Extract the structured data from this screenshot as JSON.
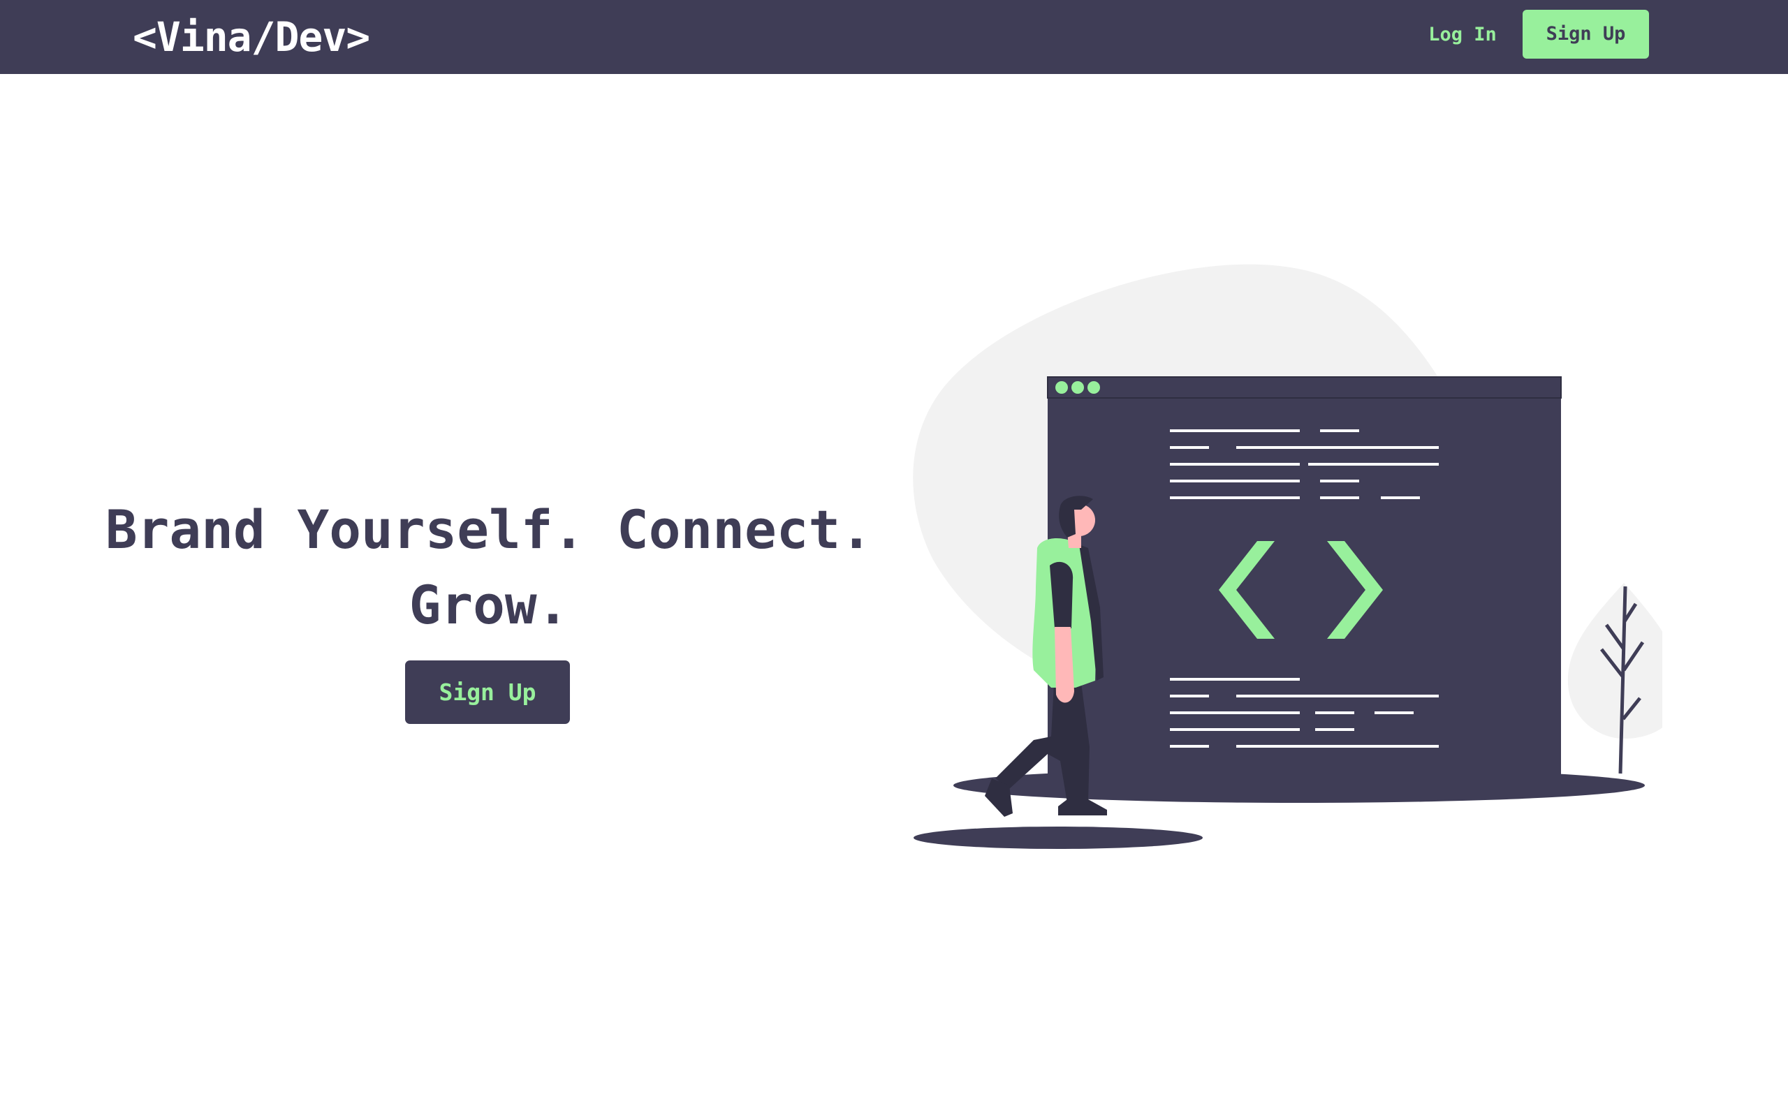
{
  "navbar": {
    "brand": "<Vina/Dev>",
    "login_label": "Log In",
    "signup_label": "Sign Up"
  },
  "hero": {
    "title_line1": "Brand Yourself. Connect.",
    "title_line2": "Grow.",
    "signup_label": "Sign Up"
  },
  "colors": {
    "dark": "#3f3d56",
    "accent": "#98f09c",
    "blob": "#f2f2f2",
    "skin": "#ffb8b8",
    "background": "#ffffff"
  },
  "illustration": {
    "icon": "code-brackets-icon",
    "subject": "person walking toward code editor window"
  }
}
